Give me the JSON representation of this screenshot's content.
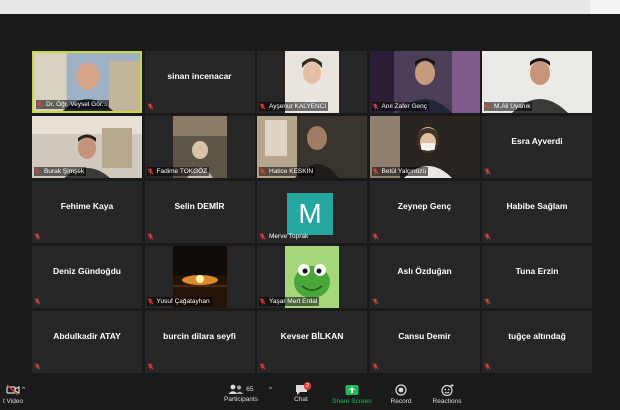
{
  "participants": [
    {
      "name": "Dr. Öğr. Veysel Gör...",
      "video": "person-teacher",
      "active": true
    },
    {
      "name": "sinan incenacar",
      "video": null
    },
    {
      "name": "Ayşenur KALYENCİ",
      "video": "person-girl"
    },
    {
      "name": "Anıl Zafer Genç",
      "video": "person-man-purple"
    },
    {
      "name": "M.Ali Uyanık",
      "video": "person-man-white"
    },
    {
      "name": "Burak Şimşek",
      "video": "person-room"
    },
    {
      "name": "Fadime TOKGÖZ",
      "video": "person-dark-room"
    },
    {
      "name": "Hatice KESKİN",
      "video": "person-window"
    },
    {
      "name": "Betül Yalçınözü",
      "video": "person-mask"
    },
    {
      "name": "Esra Ayverdi",
      "video": null
    },
    {
      "name": "Fehime Kaya",
      "video": null
    },
    {
      "name": "Selin DEMİR",
      "video": null
    },
    {
      "name": "Merve Toprak",
      "video": "avatar-letter",
      "initial": "M"
    },
    {
      "name": "Zeynep Genç",
      "video": null
    },
    {
      "name": "Habibe Sağlam",
      "video": null
    },
    {
      "name": "Deniz Gündoğdu",
      "video": null
    },
    {
      "name": "Yusuf Çağatayhan",
      "video": "sunset-image"
    },
    {
      "name": "Yaşar Mert Erdal",
      "video": "frog-image"
    },
    {
      "name": "Aslı Özduğan",
      "video": null
    },
    {
      "name": "Tuna Erzin",
      "video": null
    },
    {
      "name": "Abdulkadir ATAY",
      "video": null
    },
    {
      "name": "burcin dilara seyfi",
      "video": null
    },
    {
      "name": "Kevser BİLKAN",
      "video": null
    },
    {
      "name": "Cansu Demir",
      "video": null
    },
    {
      "name": "tuğçe altındağ",
      "video": null
    }
  ],
  "toolbar": {
    "start_video": "t Video",
    "participants_label": "Participants",
    "participants_count": "65",
    "chat_label": "Chat",
    "chat_badge": "2",
    "share_label": "Share Screen",
    "record_label": "Record",
    "reactions_label": "Reactions"
  },
  "colors": {
    "tile_bg": "#262626",
    "active_border": "#c8d93a",
    "muted_mic": "#e0403a",
    "share_green": "#1fb956",
    "avatar_teal": "#26a6a0",
    "chat_badge": "#e0403a"
  }
}
